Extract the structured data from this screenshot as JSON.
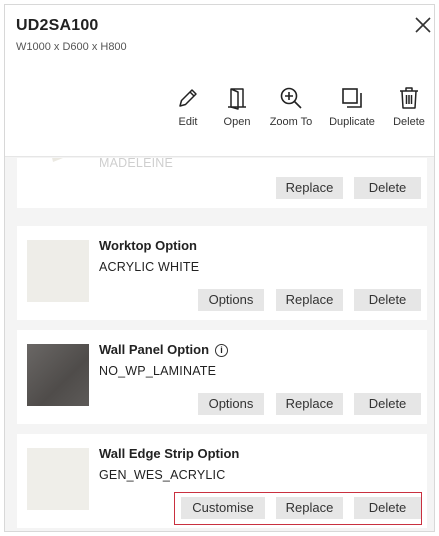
{
  "header": {
    "title": "UD2SA100",
    "dimensions": "W1000 x D600 x H800",
    "close_icon": "close-icon"
  },
  "toolbar": {
    "items": [
      {
        "label": "Edit",
        "icon": "pencil-icon"
      },
      {
        "label": "Open",
        "icon": "door-icon"
      },
      {
        "label": "Zoom To",
        "icon": "zoom-in-icon"
      },
      {
        "label": "Duplicate",
        "icon": "duplicate-icon"
      },
      {
        "label": "Delete",
        "icon": "trash-icon"
      }
    ]
  },
  "options": [
    {
      "title": "",
      "value": "MADELEINE",
      "buttons": [
        "Replace",
        "Delete"
      ]
    },
    {
      "title": "Worktop Option",
      "value": "ACRYLIC WHITE",
      "swatch_color": "#eeede8",
      "buttons": [
        "Options",
        "Replace",
        "Delete"
      ]
    },
    {
      "title": "Wall Panel Option",
      "value": "NO_WP_LAMINATE",
      "swatch_color": "#5e5b59",
      "info_icon": "i",
      "buttons": [
        "Options",
        "Replace",
        "Delete"
      ]
    },
    {
      "title": "Wall Edge Strip Option",
      "value": "GEN_WES_ACRYLIC",
      "swatch_color": "#efeee9",
      "buttons": [
        "Customise",
        "Replace",
        "Delete"
      ],
      "highlighted": true
    }
  ],
  "colors": {
    "highlight": "#c9303f",
    "button_bg": "#e6e6e6",
    "panel_bg": "#f4f4f4"
  }
}
